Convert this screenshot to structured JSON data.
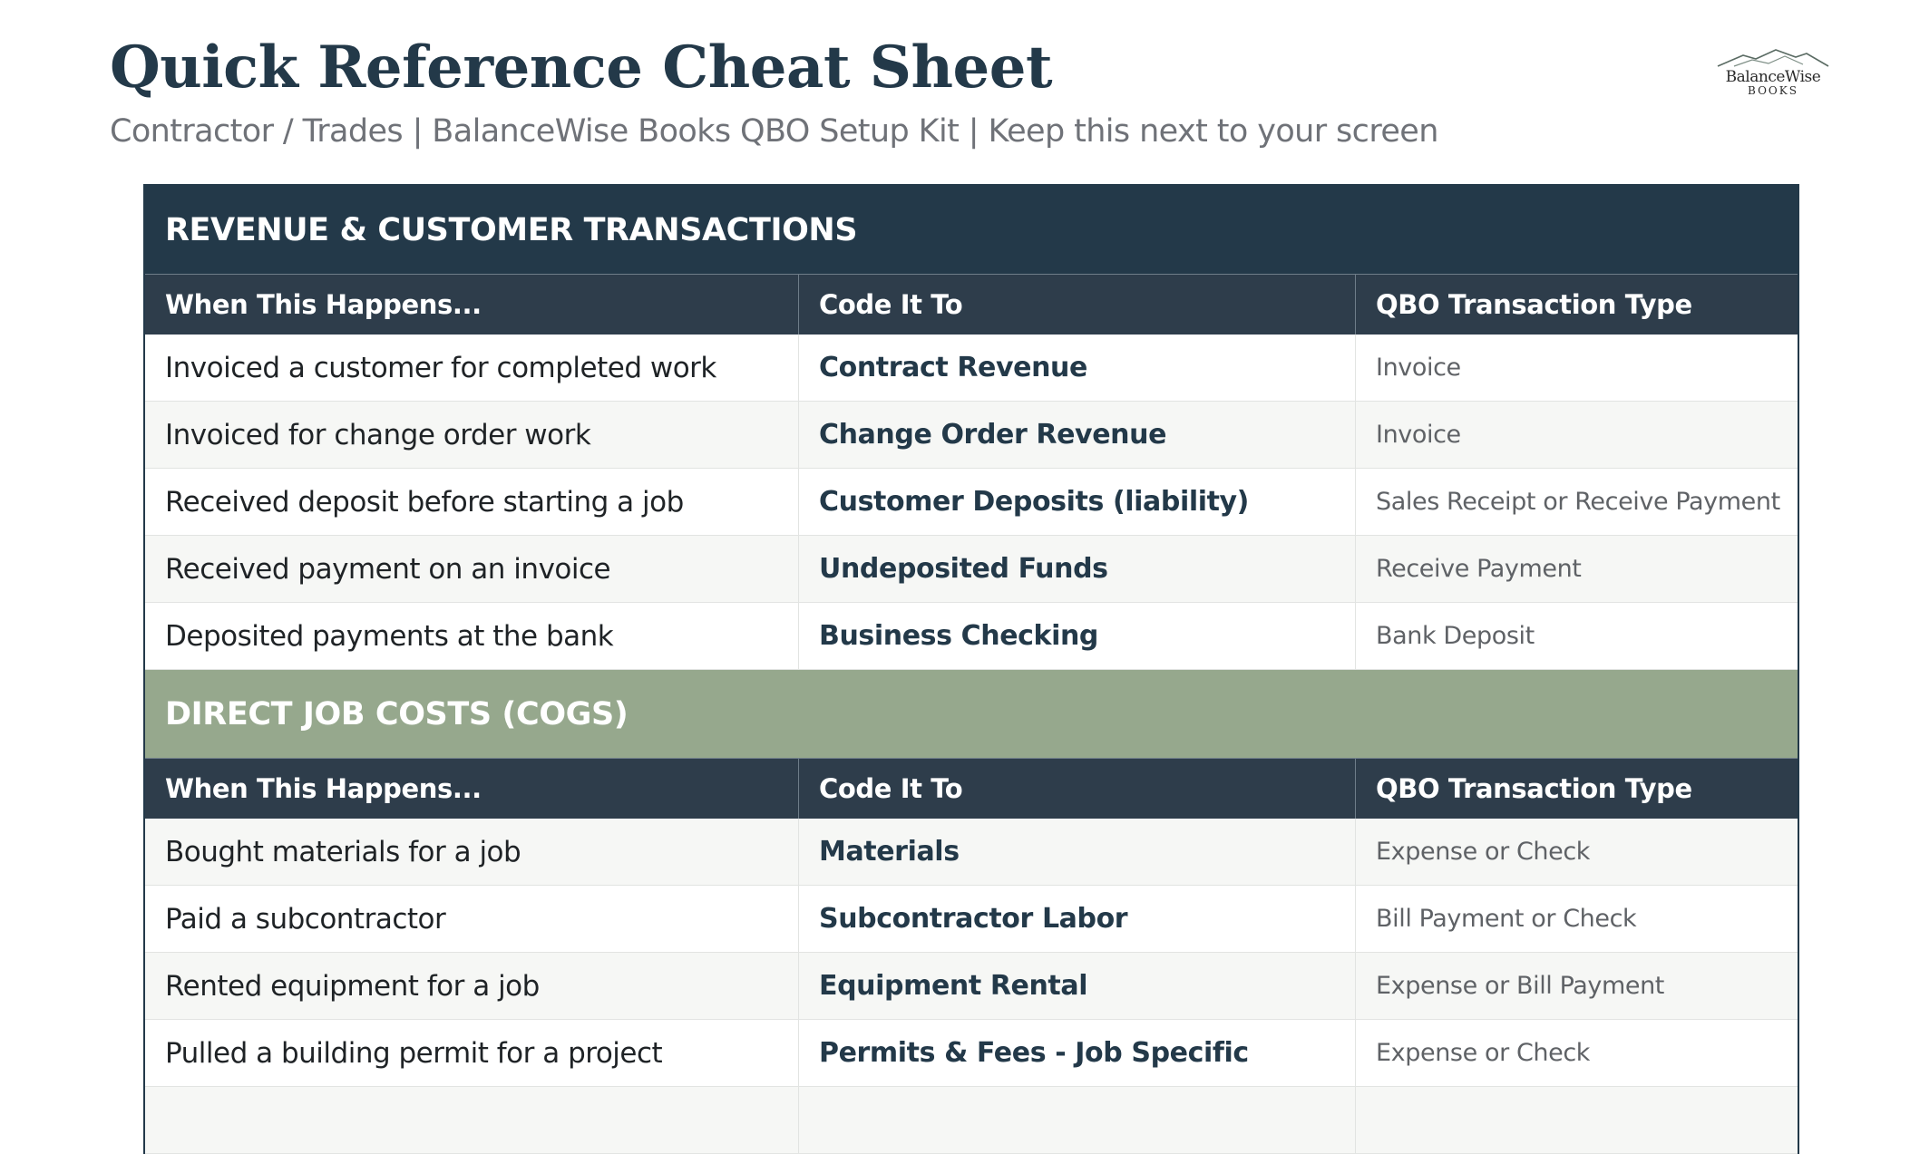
{
  "header": {
    "title": "Quick Reference Cheat Sheet",
    "subtitle": "Contractor / Trades | BalanceWise Books QBO Setup Kit | Keep this next to your screen",
    "logo_name": "BalanceWise",
    "logo_sub": "BOOKS"
  },
  "columns": {
    "when": "When This Happens...",
    "code": "Code It To",
    "type": "QBO Transaction Type"
  },
  "sections": [
    {
      "title": "REVENUE & CUSTOMER TRANSACTIONS",
      "color": "#233949",
      "rows": [
        {
          "when": "Invoiced a customer for completed work",
          "code": "Contract Revenue",
          "type": "Invoice"
        },
        {
          "when": "Invoiced for change order work",
          "code": "Change Order Revenue",
          "type": "Invoice"
        },
        {
          "when": "Received deposit before starting a job",
          "code": "Customer Deposits (liability)",
          "type": "Sales Receipt or Receive Payment"
        },
        {
          "when": "Received payment on an invoice",
          "code": "Undeposited Funds",
          "type": "Receive Payment"
        },
        {
          "when": "Deposited payments at the bank",
          "code": "Business Checking",
          "type": "Bank Deposit"
        }
      ]
    },
    {
      "title": "DIRECT JOB COSTS (COGS)",
      "color": "#96a88d",
      "rows": [
        {
          "when": "Bought materials for a job",
          "code": "Materials",
          "type": "Expense or Check"
        },
        {
          "when": "Paid a subcontractor",
          "code": "Subcontractor Labor",
          "type": "Bill Payment or Check"
        },
        {
          "when": "Rented equipment for a job",
          "code": "Equipment Rental",
          "type": "Expense or Bill Payment"
        },
        {
          "when": "Pulled a building permit for a project",
          "code": "Permits & Fees - Job Specific",
          "type": "Expense or Check"
        }
      ]
    }
  ]
}
